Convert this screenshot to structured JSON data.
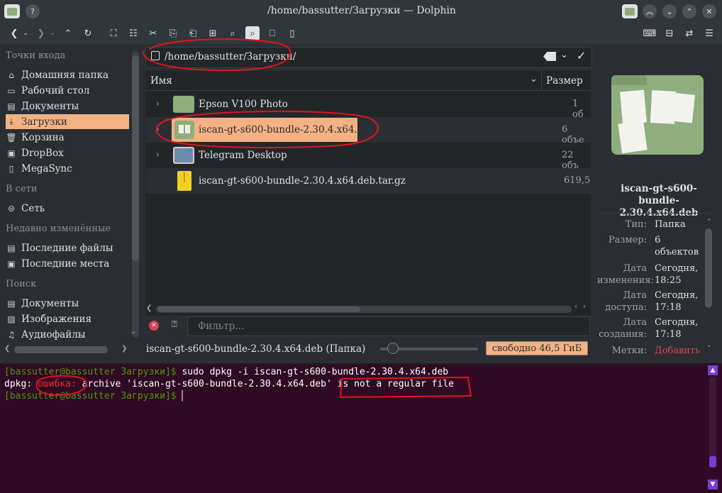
{
  "window": {
    "title": "/home/bassutter/Загрузки — Dolphin"
  },
  "sidebar": {
    "places_heading": "Точки входа",
    "places": [
      {
        "label": "Домашняя папка",
        "icon": "home-icon"
      },
      {
        "label": "Рабочий стол",
        "icon": "desktop-icon"
      },
      {
        "label": "Документы",
        "icon": "documents-icon"
      },
      {
        "label": "Загрузки",
        "icon": "download-icon",
        "active": true
      },
      {
        "label": "Корзина",
        "icon": "trash-icon"
      },
      {
        "label": "DropBox",
        "icon": "folder-icon"
      },
      {
        "label": "MegaSync",
        "icon": "folder-icon"
      }
    ],
    "network_heading": "В сети",
    "network": [
      {
        "label": "Сеть",
        "icon": "network-icon"
      }
    ],
    "recent_heading": "Недавно изменённые",
    "recent": [
      {
        "label": "Последние файлы",
        "icon": "recent-files-icon"
      },
      {
        "label": "Последние места",
        "icon": "recent-places-icon"
      }
    ],
    "search_heading": "Поиск",
    "search": [
      {
        "label": "Документы",
        "icon": "documents-icon"
      },
      {
        "label": "Изображения",
        "icon": "images-icon"
      },
      {
        "label": "Аудиофайлы",
        "icon": "audio-icon"
      }
    ]
  },
  "location": {
    "path": "/home/bassutter/Загрузки/"
  },
  "columns": {
    "name": "Имя",
    "size": "Размер"
  },
  "files": [
    {
      "name": "Epson V100 Photo",
      "size": "1 об",
      "type": "folder"
    },
    {
      "name": "iscan-gt-s600-bundle-2.30.4.x64.deb",
      "size": "6 объе",
      "type": "folder",
      "selected": true
    },
    {
      "name": "Telegram Desktop",
      "size": "22 объ",
      "type": "folder"
    },
    {
      "name": "iscan-gt-s600-bundle-2.30.4.x64.deb.tar.gz",
      "size": "619,5",
      "type": "archive"
    }
  ],
  "filter": {
    "placeholder": "Фильтр..."
  },
  "status": {
    "text": "iscan-gt-s600-bundle-2.30.4.x64.deb (Папка)",
    "free_space": "свободно 46,5 ГиБ",
    "zoom_fraction": 0.1
  },
  "info_panel": {
    "name": "iscan-gt-s600-bundle-2.30.4.x64.deb",
    "rows": [
      {
        "label": "Тип:",
        "value": "Папка"
      },
      {
        "label": "Размер:",
        "value": "6 объектов"
      },
      {
        "label": "Дата изменения:",
        "value": "Сегодня, 18:25"
      },
      {
        "label": "Дата доступа:",
        "value": "Сегодня, 17:18"
      },
      {
        "label": "Дата создания:",
        "value": "Сегодня, 17:18"
      },
      {
        "label": "Метки:",
        "value": "Добавить"
      }
    ]
  },
  "terminal": {
    "line1_prompt": "[bassutter@bassutter Загрузки]$ ",
    "line1_cmd": "sudo dpkg -i iscan-gt-s600-bundle-2.30.4.x64.deb",
    "line2_prefix": "dpkg: ",
    "line2_error": "ошибка:",
    "line2_rest": " archive 'iscan-gt-s600-bundle-2.30.4.x64.deb' is not a regular file",
    "line3_prompt": "[bassutter@bassutter Загрузки]$ ",
    "colors": {
      "background": "#300a24",
      "prompt": "#4e9a06",
      "error": "#ef2929",
      "text": "#ffffff"
    }
  },
  "colors": {
    "selection": "#f4b183",
    "annotation": "#e0141e",
    "folder": "#8fad7d"
  }
}
